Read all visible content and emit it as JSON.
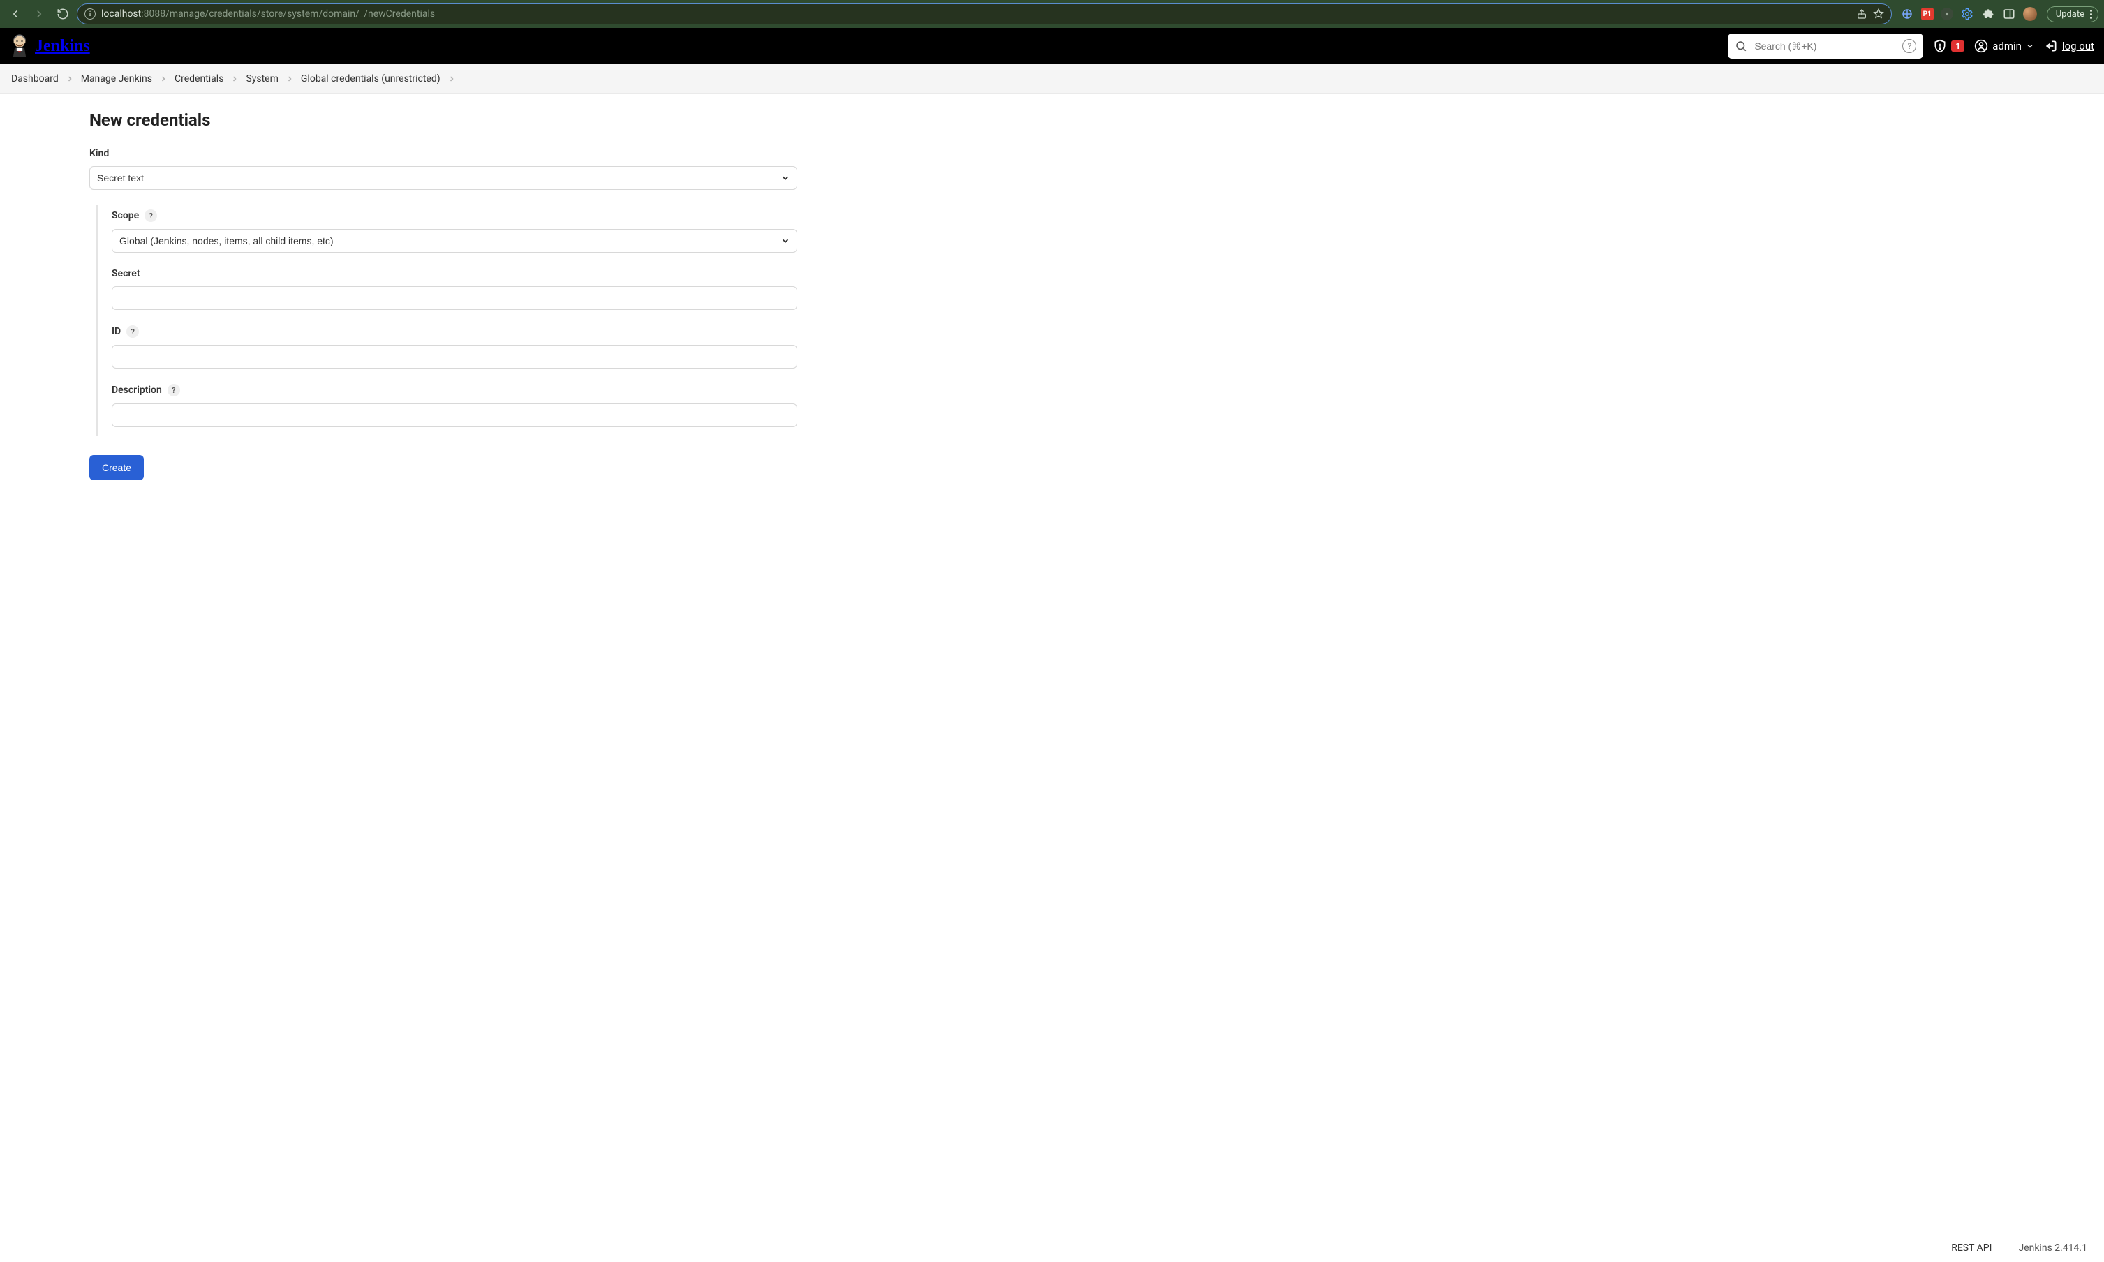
{
  "browser": {
    "url_host": "localhost",
    "url_port_path": ":8088/manage/credentials/store/system/domain/_/newCredentials",
    "update_label": "Update",
    "extensions": {
      "p1_label": "P1"
    }
  },
  "header": {
    "brand": "Jenkins",
    "search_placeholder": "Search (⌘+K)",
    "alert_count": "1",
    "user_label": "admin",
    "logout_label": "log out"
  },
  "breadcrumbs": [
    "Dashboard",
    "Manage Jenkins",
    "Credentials",
    "System",
    "Global credentials (unrestricted)"
  ],
  "page": {
    "title": "New credentials",
    "kind_label": "Kind",
    "kind_value": "Secret text",
    "scope_label": "Scope",
    "scope_value": "Global (Jenkins, nodes, items, all child items, etc)",
    "secret_label": "Secret",
    "secret_value": "",
    "id_label": "ID",
    "id_value": "",
    "description_label": "Description",
    "description_value": "",
    "submit_label": "Create"
  },
  "footer": {
    "rest_api": "REST API",
    "version": "Jenkins 2.414.1"
  }
}
